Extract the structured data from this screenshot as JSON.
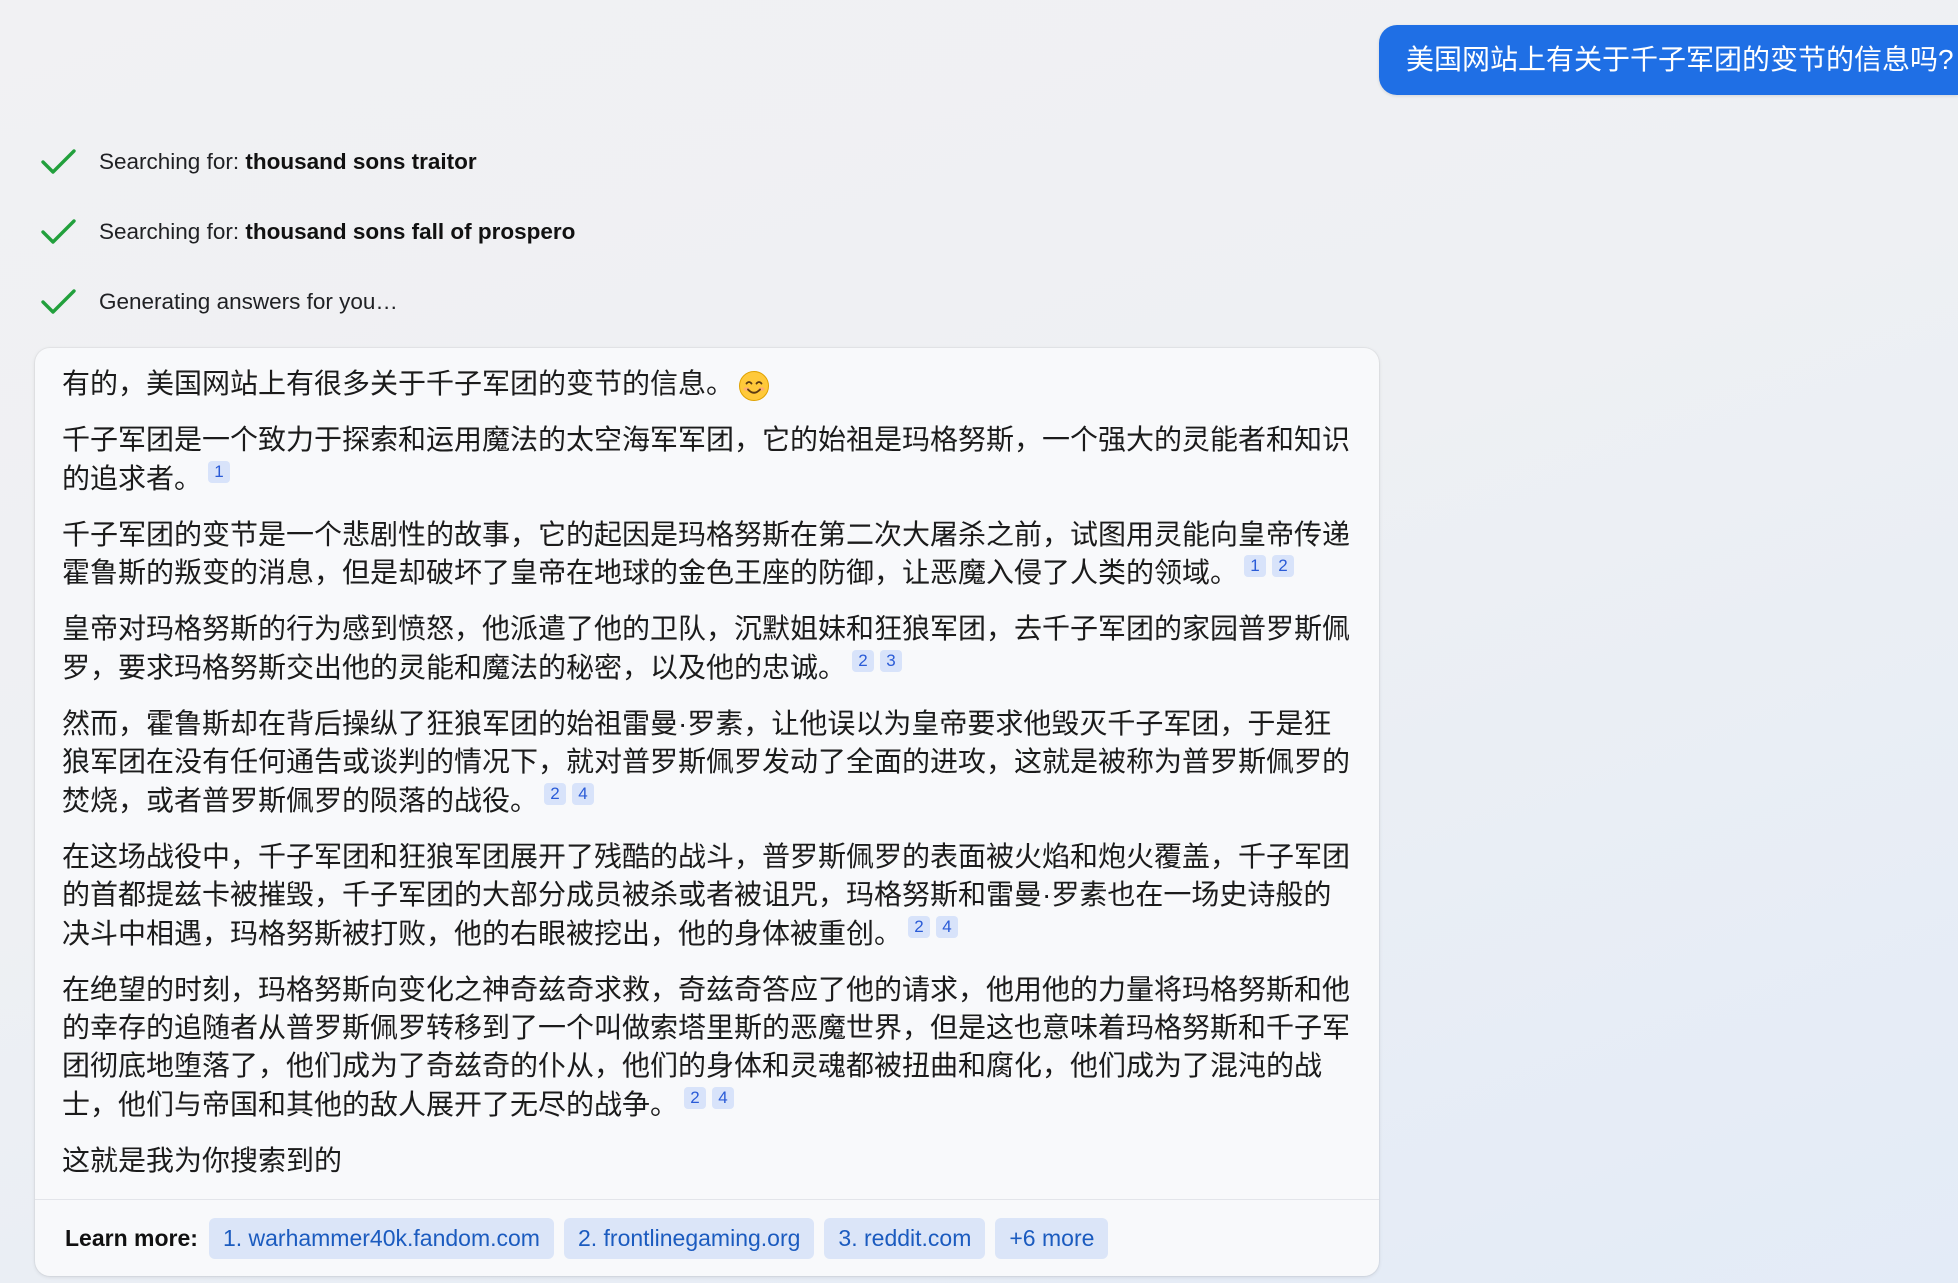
{
  "user_message": {
    "text": "美国网站上有关于千子军团的变节的信息吗?"
  },
  "status_steps": [
    {
      "icon": "checkmark-icon",
      "prefix": "Searching for:",
      "query": "thousand sons traitor"
    },
    {
      "icon": "checkmark-icon",
      "prefix": "Searching for:",
      "query": "thousand sons fall of prospero"
    },
    {
      "icon": "checkmark-icon",
      "text": "Generating answers for you…"
    }
  ],
  "answer": {
    "paragraphs": [
      {
        "text": "有的，美国网站上有很多关于千子军团的变节的信息。",
        "emoji": "smiling-face-emoji",
        "citations": []
      },
      {
        "text": "千子军团是一个致力于探索和运用魔法的太空海军军团，它的始祖是玛格努斯，一个强大的灵能者和知识的追求者。",
        "citations": [
          "1"
        ]
      },
      {
        "text": "千子军团的变节是一个悲剧性的故事，它的起因是玛格努斯在第二次大屠杀之前，试图用灵能向皇帝传递霍鲁斯的叛变的消息，但是却破坏了皇帝在地球的金色王座的防御，让恶魔入侵了人类的领域。",
        "citations": [
          "1",
          "2"
        ]
      },
      {
        "text": "皇帝对玛格努斯的行为感到愤怒，他派遣了他的卫队，沉默姐妹和狂狼军团，去千子军团的家园普罗斯佩罗，要求玛格努斯交出他的灵能和魔法的秘密，以及他的忠诚。",
        "citations": [
          "2",
          "3"
        ]
      },
      {
        "text": "然而，霍鲁斯却在背后操纵了狂狼军团的始祖雷曼·罗素，让他误以为皇帝要求他毁灭千子军团，于是狂狼军团在没有任何通告或谈判的情况下，就对普罗斯佩罗发动了全面的进攻，这就是被称为普罗斯佩罗的焚烧，或者普罗斯佩罗的陨落的战役。",
        "citations": [
          "2",
          "4"
        ]
      },
      {
        "text": "在这场战役中，千子军团和狂狼军团展开了残酷的战斗，普罗斯佩罗的表面被火焰和炮火覆盖，千子军团的首都提兹卡被摧毁，千子军团的大部分成员被杀或者被诅咒，玛格努斯和雷曼·罗素也在一场史诗般的决斗中相遇，玛格努斯被打败，他的右眼被挖出，他的身体被重创。",
        "citations": [
          "2",
          "4"
        ]
      },
      {
        "text": "在绝望的时刻，玛格努斯向变化之神奇兹奇求救，奇兹奇答应了他的请求，他用他的力量将玛格努斯和他的幸存的追随者从普罗斯佩罗转移到了一个叫做索塔里斯的恶魔世界，但是这也意味着玛格努斯和千子军团彻底地堕落了，他们成为了奇兹奇的仆从，他们的身体和灵魂都被扭曲和腐化，他们成为了混沌的战士，他们与帝国和其他的敌人展开了无尽的战争。",
        "citations": [
          "2",
          "4"
        ]
      },
      {
        "text": "这就是我为你搜索到的",
        "citations": []
      }
    ]
  },
  "learn_more": {
    "label": "Learn more:",
    "links": [
      "1. warhammer40k.fandom.com",
      "2. frontlinegaming.org",
      "3. reddit.com"
    ],
    "more_label": "+6 more"
  },
  "colors": {
    "user_bubble": "#1f6fe5",
    "check": "#22a03c",
    "citation_bg": "#d8e3fa",
    "citation_text": "#2a5bd7",
    "chip_bg": "#dbe5f8",
    "chip_text": "#1b5bbf"
  }
}
